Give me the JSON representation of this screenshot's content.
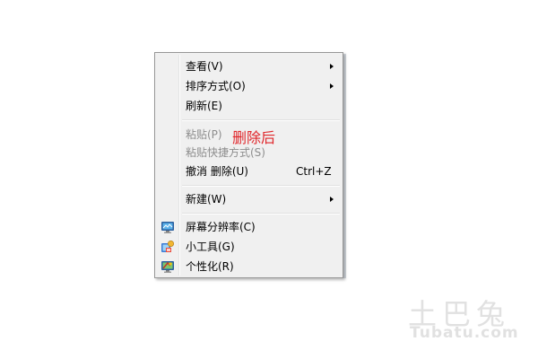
{
  "context_menu": {
    "items": [
      {
        "label": "查看(V)",
        "has_submenu": true
      },
      {
        "label": "排序方式(O)",
        "has_submenu": true
      },
      {
        "label": "刷新(E)"
      },
      {
        "label": "粘贴(P)",
        "disabled": true
      },
      {
        "label": "粘贴快捷方式(S)",
        "disabled": true
      },
      {
        "label": "撤消 删除(U)",
        "shortcut": "Ctrl+Z"
      },
      {
        "label": "新建(W)",
        "has_submenu": true
      },
      {
        "label": "屏幕分辨率(C)",
        "icon": "screen-resolution-icon"
      },
      {
        "label": "小工具(G)",
        "icon": "gadgets-icon"
      },
      {
        "label": "个性化(R)",
        "icon": "personalize-icon"
      }
    ]
  },
  "annotation": {
    "text": "删除后",
    "color": "#e0262a"
  },
  "watermark": {
    "chinese": "土巴兔",
    "english": "Tubatu.com"
  },
  "colors": {
    "menu_background": "#f0f0f0",
    "menu_border": "#979797",
    "disabled_text": "#8d8d8d"
  }
}
